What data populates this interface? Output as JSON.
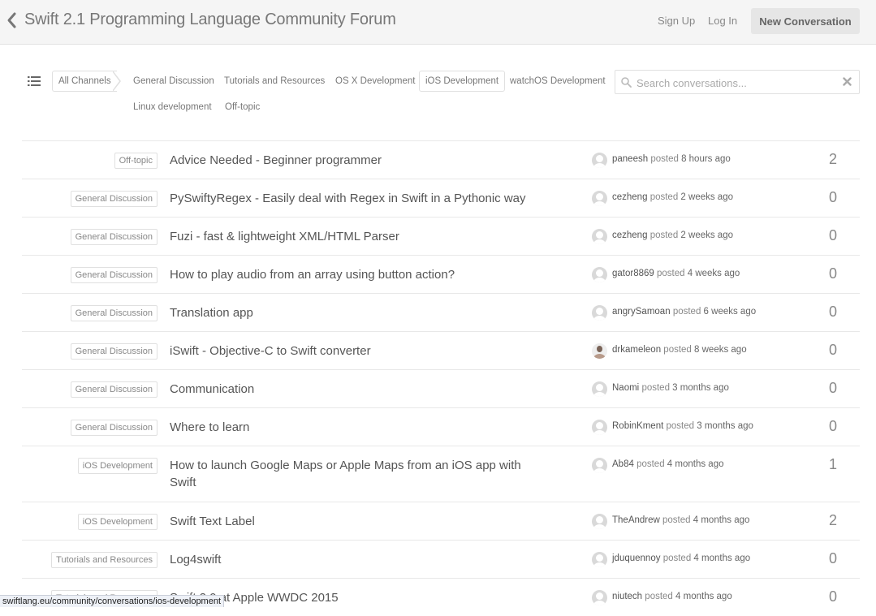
{
  "header": {
    "title": "Swift 2.1 Programming Language Community Forum",
    "sign_up": "Sign Up",
    "log_in": "Log In",
    "new_conversation": "New Conversation"
  },
  "channels": {
    "all": "All Channels",
    "items": [
      "General Discussion",
      "Tutorials and Resources",
      "OS X Development",
      "iOS Development",
      "watchOS Development",
      "Linux development",
      "Off-topic"
    ],
    "selected": "iOS Development"
  },
  "search": {
    "placeholder": "Search conversations..."
  },
  "conversations": [
    {
      "channel": "Off-topic",
      "title": "Advice Needed - Beginner programmer",
      "user": "paneesh",
      "action": "posted",
      "time": "8 hours ago",
      "count": "2"
    },
    {
      "channel": "General Discussion",
      "title": "PySwiftyRegex - Easily deal with Regex in Swift in a Pythonic way",
      "user": "cezheng",
      "action": "posted",
      "time": "2 weeks ago",
      "count": "0"
    },
    {
      "channel": "General Discussion",
      "title": "Fuzi - fast & lightweight XML/HTML Parser",
      "user": "cezheng",
      "action": "posted",
      "time": "2 weeks ago",
      "count": "0"
    },
    {
      "channel": "General Discussion",
      "title": "How to play audio from an array using button action?",
      "user": "gator8869",
      "action": "posted",
      "time": "4 weeks ago",
      "count": "0"
    },
    {
      "channel": "General Discussion",
      "title": "Translation app",
      "user": "angrySamoan",
      "action": "posted",
      "time": "6 weeks ago",
      "count": "0"
    },
    {
      "channel": "General Discussion",
      "title": "iSwift - Objective-C to Swift converter",
      "user": "drkameleon",
      "action": "posted",
      "time": "8 weeks ago",
      "count": "0"
    },
    {
      "channel": "General Discussion",
      "title": "Communication",
      "user": "Naomi",
      "action": "posted",
      "time": "3 months ago",
      "count": "0"
    },
    {
      "channel": "General Discussion",
      "title": "Where to learn",
      "user": "RobinKment",
      "action": "posted",
      "time": "3 months ago",
      "count": "0"
    },
    {
      "channel": "iOS Development",
      "title": "How to launch Google Maps or Apple Maps from an iOS app with Swift",
      "user": "Ab84",
      "action": "posted",
      "time": "4 months ago",
      "count": "1"
    },
    {
      "channel": "iOS Development",
      "title": "Swift Text Label",
      "user": "TheAndrew",
      "action": "posted",
      "time": "4 months ago",
      "count": "2"
    },
    {
      "channel": "Tutorials and Resources",
      "title": "Log4swift",
      "user": "jduquennoy",
      "action": "posted",
      "time": "4 months ago",
      "count": "0"
    },
    {
      "channel": "Tutorials and Resources",
      "title": "Swift 2.0 at Apple WWDC 2015",
      "user": "niutech",
      "action": "posted",
      "time": "4 months ago",
      "count": "0"
    }
  ],
  "status_bar": {
    "url": "swiftlang.eu/community/conversations/ios-development"
  }
}
